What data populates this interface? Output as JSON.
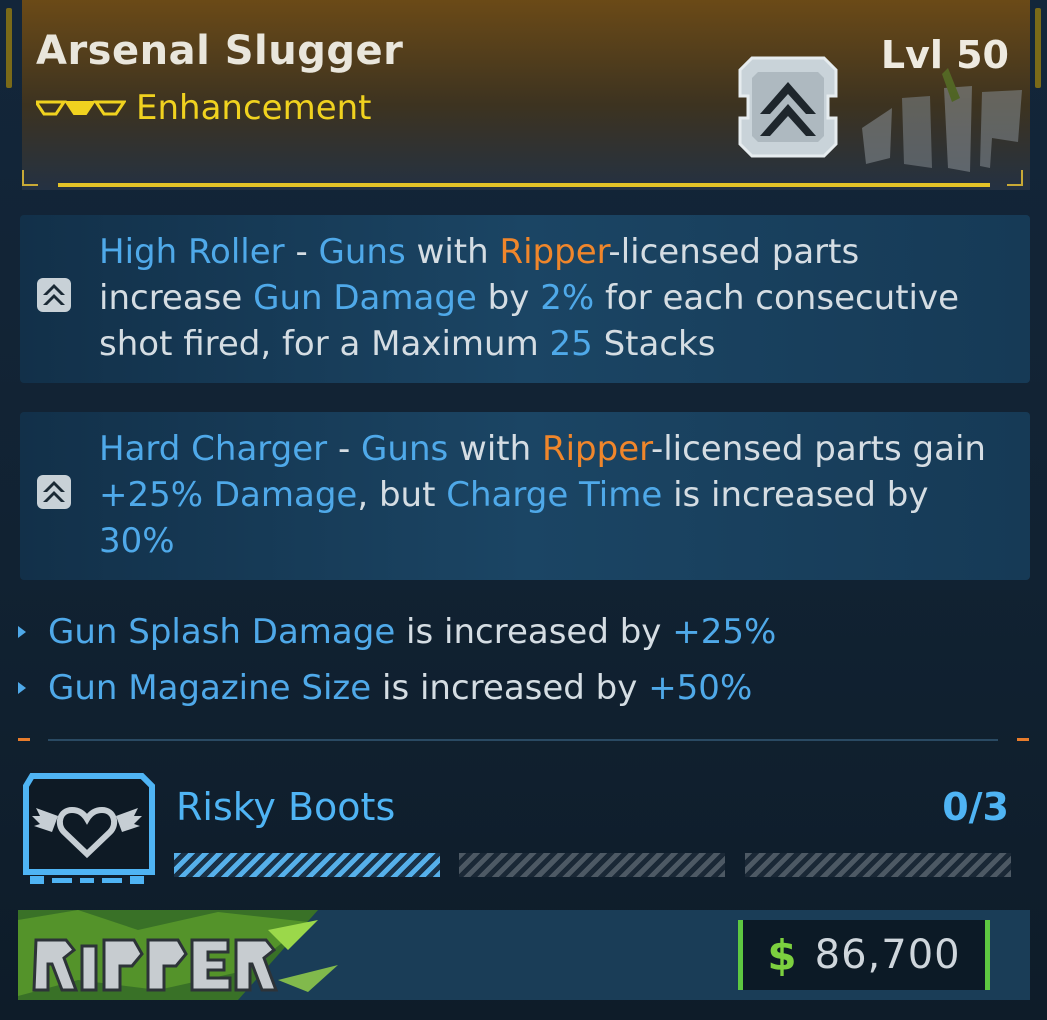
{
  "item": {
    "name": "Arsenal Slugger",
    "level": "Lvl 50",
    "rarity": "Enhancement",
    "emblem_icon": "chevron-up-emblem-icon",
    "accent_color": "#e3c227"
  },
  "perks": [
    {
      "icon": "chevron-up-icon",
      "segments": [
        {
          "t": "High Roller",
          "c": "blue"
        },
        {
          "t": " - ",
          "c": "plain"
        },
        {
          "t": "Guns",
          "c": "blue"
        },
        {
          "t": " with ",
          "c": "plain"
        },
        {
          "t": "Ripper",
          "c": "orange"
        },
        {
          "t": "-licensed parts increase ",
          "c": "plain"
        },
        {
          "t": "Gun Damage",
          "c": "blue"
        },
        {
          "t": " by ",
          "c": "plain"
        },
        {
          "t": "2%",
          "c": "blue"
        },
        {
          "t": " for each consecutive shot fired, for a Maximum ",
          "c": "plain"
        },
        {
          "t": "25",
          "c": "blue"
        },
        {
          "t": " Stacks",
          "c": "plain"
        }
      ]
    },
    {
      "icon": "chevron-up-icon",
      "segments": [
        {
          "t": "Hard Charger",
          "c": "blue"
        },
        {
          "t": " - ",
          "c": "plain"
        },
        {
          "t": "Guns",
          "c": "blue"
        },
        {
          "t": " with ",
          "c": "plain"
        },
        {
          "t": "Ripper",
          "c": "orange"
        },
        {
          "t": "-licensed parts gain ",
          "c": "plain"
        },
        {
          "t": "+25% Damage",
          "c": "blue"
        },
        {
          "t": ", but ",
          "c": "plain"
        },
        {
          "t": "Charge Time",
          "c": "blue"
        },
        {
          "t": " is increased by ",
          "c": "plain"
        },
        {
          "t": "30%",
          "c": "blue"
        }
      ]
    }
  ],
  "stats": [
    {
      "name": "Gun Splash Damage",
      "mid": " is increased by ",
      "value": "+25%"
    },
    {
      "name": "Gun Magazine Size",
      "mid": " is increased by ",
      "value": "+50%"
    }
  ],
  "set_bonus": {
    "name": "Risky Boots",
    "count": "0/3",
    "progress": 0.333,
    "segments": 3,
    "icon": "winged-heart-icon"
  },
  "footer": {
    "manufacturer_logo": "ripper-logo-icon",
    "currency_symbol": "$",
    "price": "86,700",
    "price_color": "#5ec741"
  }
}
